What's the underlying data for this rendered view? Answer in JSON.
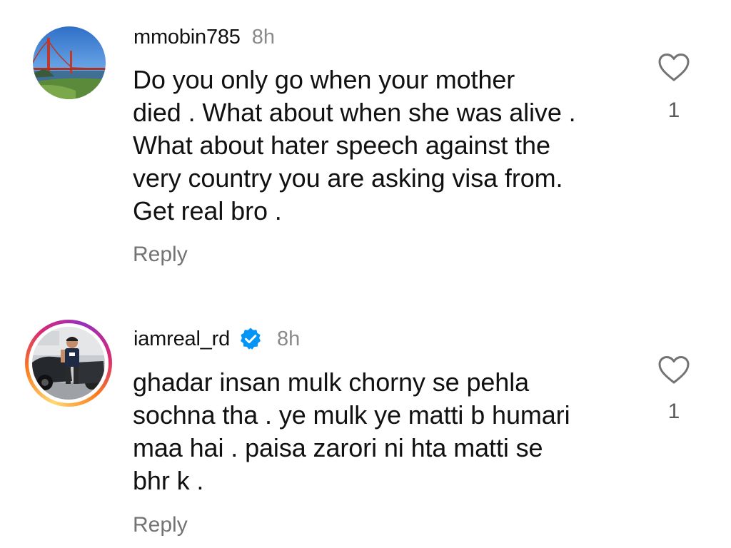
{
  "comments": [
    {
      "username": "mmobin785",
      "time": "8h",
      "verified": false,
      "text": "Do you only go when your mother\ndied . What about when she was alive .\nWhat about  hater speech against the\nvery country you are asking visa from.\nGet real bro .",
      "likes": "1",
      "reply_label": "Reply",
      "avatar": "golden-gate-bridge-photo"
    },
    {
      "username": "iamreal_rd",
      "time": "8h",
      "verified": true,
      "text": "ghadar insan mulk chorny se pehla\nsochna tha . ye mulk ye matti b humari\nmaa hai . paisa zarori ni hta matti se\nbhr k .",
      "likes": "1",
      "reply_label": "Reply",
      "avatar": "man-with-car-photo",
      "has_story_ring": true
    }
  ],
  "icons": {
    "like": "heart-outline-icon",
    "verified": "verified-badge-icon"
  },
  "colors": {
    "verified_blue": "#0095f6",
    "secondary_text": "#8a8a8a",
    "reply_text": "#737373"
  }
}
